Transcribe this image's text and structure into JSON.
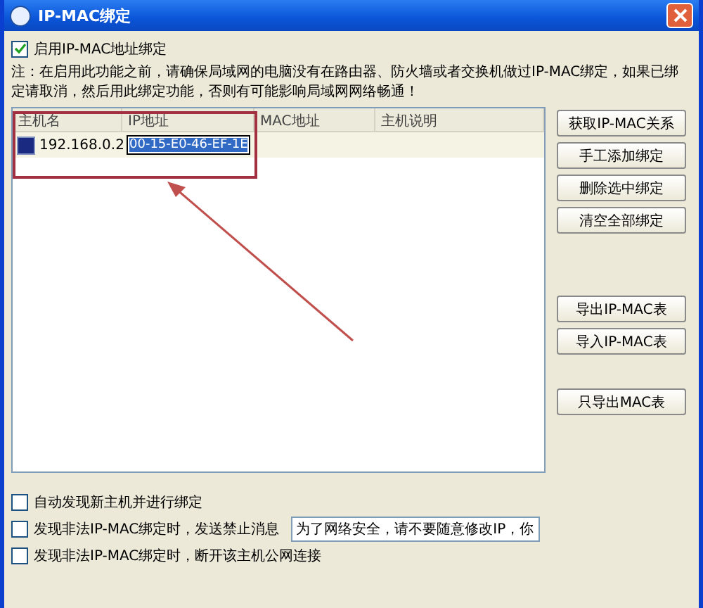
{
  "window": {
    "title": "IP-MAC绑定"
  },
  "enable_binding": {
    "label": "启用IP-MAC地址绑定",
    "checked": true
  },
  "note": "注：在启用此功能之前，请确保局域网的电脑没有在路由器、防火墙或者交换机做过IP-MAC绑定，如果已绑定请取消，然后用此绑定功能，否则有可能影响局域网网络畅通！",
  "table": {
    "columns": [
      "主机名",
      "IP地址",
      "MAC地址",
      "主机说明"
    ],
    "rows": [
      {
        "selected": true,
        "host": "192.168.0.2",
        "editing_value": "00-15-E0-46-EF-1E"
      }
    ]
  },
  "button_groups": [
    [
      "获取IP-MAC关系",
      "手工添加绑定",
      "删除选中绑定",
      "清空全部绑定"
    ],
    [
      "导出IP-MAC表",
      "导入IP-MAC表"
    ],
    [
      "只导出MAC表"
    ]
  ],
  "options": [
    {
      "kind": "checkbox",
      "label": "自动发现新主机并进行绑定",
      "checked": false
    },
    {
      "kind": "checkbox-with-field",
      "label": "发现非法IP-MAC绑定时，发送禁止消息",
      "checked": false,
      "value": "为了网络安全，请不要随意修改IP，你"
    },
    {
      "kind": "checkbox",
      "label": "发现非法IP-MAC绑定时，断开该主机公网连接",
      "checked": false
    }
  ]
}
